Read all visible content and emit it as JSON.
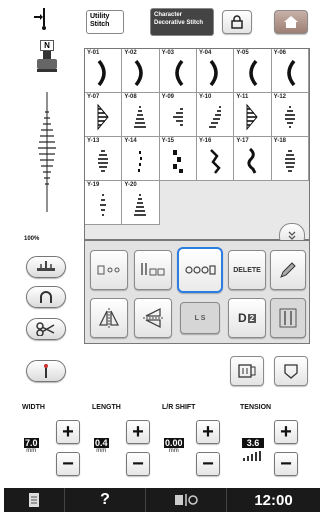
{
  "top_tabs": {
    "utility": "Utility Stitch",
    "character": "Character Decorative Stitch"
  },
  "presser_foot": {
    "letter": "N"
  },
  "stitch_grid": {
    "cells": [
      {
        "num": "Y-01",
        "shape": "crescent-r"
      },
      {
        "num": "Y-02",
        "shape": "crescent-r"
      },
      {
        "num": "Y-03",
        "shape": "crescent-l"
      },
      {
        "num": "Y-04",
        "shape": "crescent-r"
      },
      {
        "num": "Y-05",
        "shape": "crescent-l"
      },
      {
        "num": "Y-06",
        "shape": "crescent-l"
      },
      {
        "num": "Y-07",
        "shape": "half-r"
      },
      {
        "num": "Y-08",
        "shape": "triangle"
      },
      {
        "num": "Y-09",
        "shape": "half-l"
      },
      {
        "num": "Y-10",
        "shape": "wedge"
      },
      {
        "num": "Y-11",
        "shape": "half-r"
      },
      {
        "num": "Y-12",
        "shape": "diamond"
      },
      {
        "num": "Y-13",
        "shape": "oval"
      },
      {
        "num": "Y-14",
        "shape": "dots"
      },
      {
        "num": "Y-15",
        "shape": "steps"
      },
      {
        "num": "Y-16",
        "shape": "zig"
      },
      {
        "num": "Y-17",
        "shape": "wave"
      },
      {
        "num": "Y-18",
        "shape": "oval"
      },
      {
        "num": "Y-19",
        "shape": "narrow"
      },
      {
        "num": "Y-20",
        "shape": "triangle"
      }
    ]
  },
  "zoom": "100%",
  "edit_buttons": {
    "delete_label": "DELETE",
    "ls_label": "L S",
    "repeat_label": "2"
  },
  "params": [
    {
      "label": "WIDTH",
      "value": "7.0",
      "unit": "mm"
    },
    {
      "label": "LENGTH",
      "value": "0.4",
      "unit": "mm"
    },
    {
      "label": "L/R SHIFT",
      "value": "0.00",
      "unit": "mm"
    },
    {
      "label": "TENSION",
      "value": "3.6",
      "unit": ""
    }
  ],
  "bottom_bar": {
    "help": "?",
    "time": "12:00"
  },
  "colors": {
    "accent": "#2a7de1",
    "bar": "#1a1a1a",
    "selected_bg": "#e2e8f0"
  }
}
